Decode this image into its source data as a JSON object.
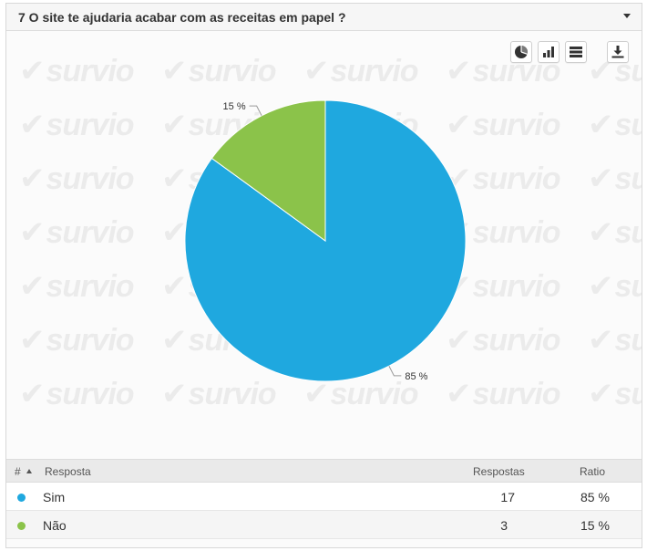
{
  "question": {
    "title": "7 O site te ajudaria acabar com as receitas em papel ?"
  },
  "watermark": {
    "text": "survio"
  },
  "toolbar": {
    "buttons": [
      {
        "icon": "pie-chart-icon"
      },
      {
        "icon": "bar-chart-icon"
      },
      {
        "icon": "table-view-icon"
      },
      {
        "icon": "download-icon"
      }
    ]
  },
  "chart_data": {
    "type": "pie",
    "categories": [
      "Sim",
      "Não"
    ],
    "values": [
      85,
      15
    ],
    "labels": [
      "85 %",
      "15 %"
    ],
    "colors": [
      "#1fa8df",
      "#8bc34a"
    ],
    "legend": "none"
  },
  "table": {
    "headers": {
      "num": "#",
      "answer": "Resposta",
      "count": "Respostas",
      "ratio": "Ratio"
    },
    "rows": [
      {
        "answer": "Sim",
        "count": "17",
        "ratio": "85 %",
        "color": "#1fa8df"
      },
      {
        "answer": "Não",
        "count": "3",
        "ratio": "15 %",
        "color": "#8bc34a"
      }
    ]
  }
}
